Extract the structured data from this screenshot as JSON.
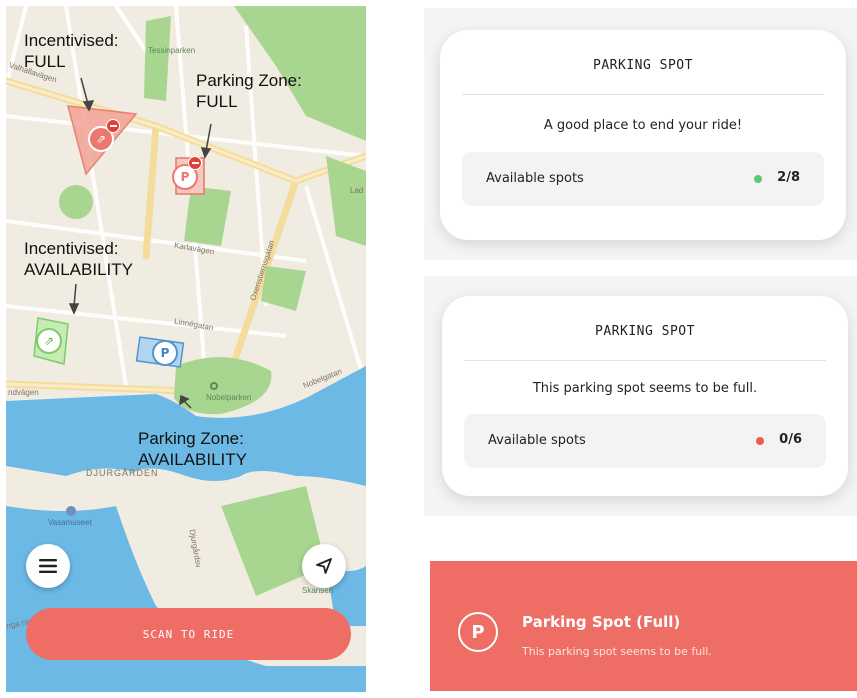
{
  "map": {
    "callouts": {
      "incentivised_full": [
        "Incentivised:",
        "FULL"
      ],
      "zone_full": [
        "Parking Zone:",
        "FULL"
      ],
      "incentivised_avail": [
        "Incentivised:",
        "AVAILABILITY"
      ],
      "zone_avail": [
        "Parking Zone:",
        "AVAILABILITY"
      ]
    },
    "streets": {
      "valhallavagen": "Valhallavägen",
      "karlavagen": "Karlavägen",
      "oxenstiernsgatan": "Oxenstiernsgatan",
      "linnegatan": "Linnégatan",
      "strandvagen": "ndvägen",
      "nobelgatan": "Nobelgatan",
      "ladugard": "Lad",
      "djurgarden": "DJURGÅRDEN",
      "sodra": "nga raden",
      "djurgardsv": "Djurgårdsv"
    },
    "places": {
      "tessinparken": "Tessinparken",
      "nobelparken": "Nobelparken",
      "vasamuseet": "Vasamuseet",
      "skansen": "Skansen"
    },
    "marker_letter": "P",
    "scan_label": "SCAN TO RIDE",
    "menu_icon": "hamburger-menu-icon",
    "locate_icon": "navigation-arrow-icon"
  },
  "cards": [
    {
      "title": "PARKING SPOT",
      "message": "A good place to end your ride!",
      "spots_label": "Available spots",
      "spots_value": "2/8",
      "status_color": "#5cc96a"
    },
    {
      "title": "PARKING SPOT",
      "message": "This parking spot seems to be full.",
      "spots_label": "Available spots",
      "spots_value": "0/6",
      "status_color": "#ee5a52"
    }
  ],
  "banner": {
    "icon_letter": "P",
    "title": "Parking Spot (Full)",
    "subtitle": "This parking spot seems to be full."
  },
  "colors": {
    "accent": "#ee6e66",
    "water": "#6cb9e6",
    "park": "#9fd28b"
  }
}
